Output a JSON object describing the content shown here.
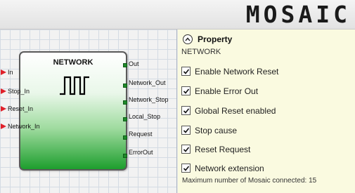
{
  "header": {
    "logo_text": "MOSAIC"
  },
  "block": {
    "title": "NETWORK",
    "inputs": [
      "In",
      "Stop_In",
      "Reset_In",
      "Network_In"
    ],
    "outputs": [
      "Out",
      "Network_Out",
      "Network_Stop",
      "Local_Stop",
      "Request",
      "ErrorOut"
    ],
    "input_arrow_color": "#e0202a",
    "output_port_color": "#1f8a2a",
    "block_icon": "pulse-train-icon"
  },
  "property": {
    "title": "Property",
    "subtitle": "NETWORK",
    "collapse_icon": "chevron-up-icon",
    "options": [
      {
        "label": "Enable Network Reset",
        "checked": true
      },
      {
        "label": "Enable Error Out",
        "checked": true
      },
      {
        "label": "Global Reset enabled",
        "checked": true
      },
      {
        "label": "Stop cause",
        "checked": true
      },
      {
        "label": "Reset Request",
        "checked": true
      },
      {
        "label": "Network extension",
        "checked": true
      }
    ],
    "footer": "Maximum number of Mosaic connected: 15"
  }
}
